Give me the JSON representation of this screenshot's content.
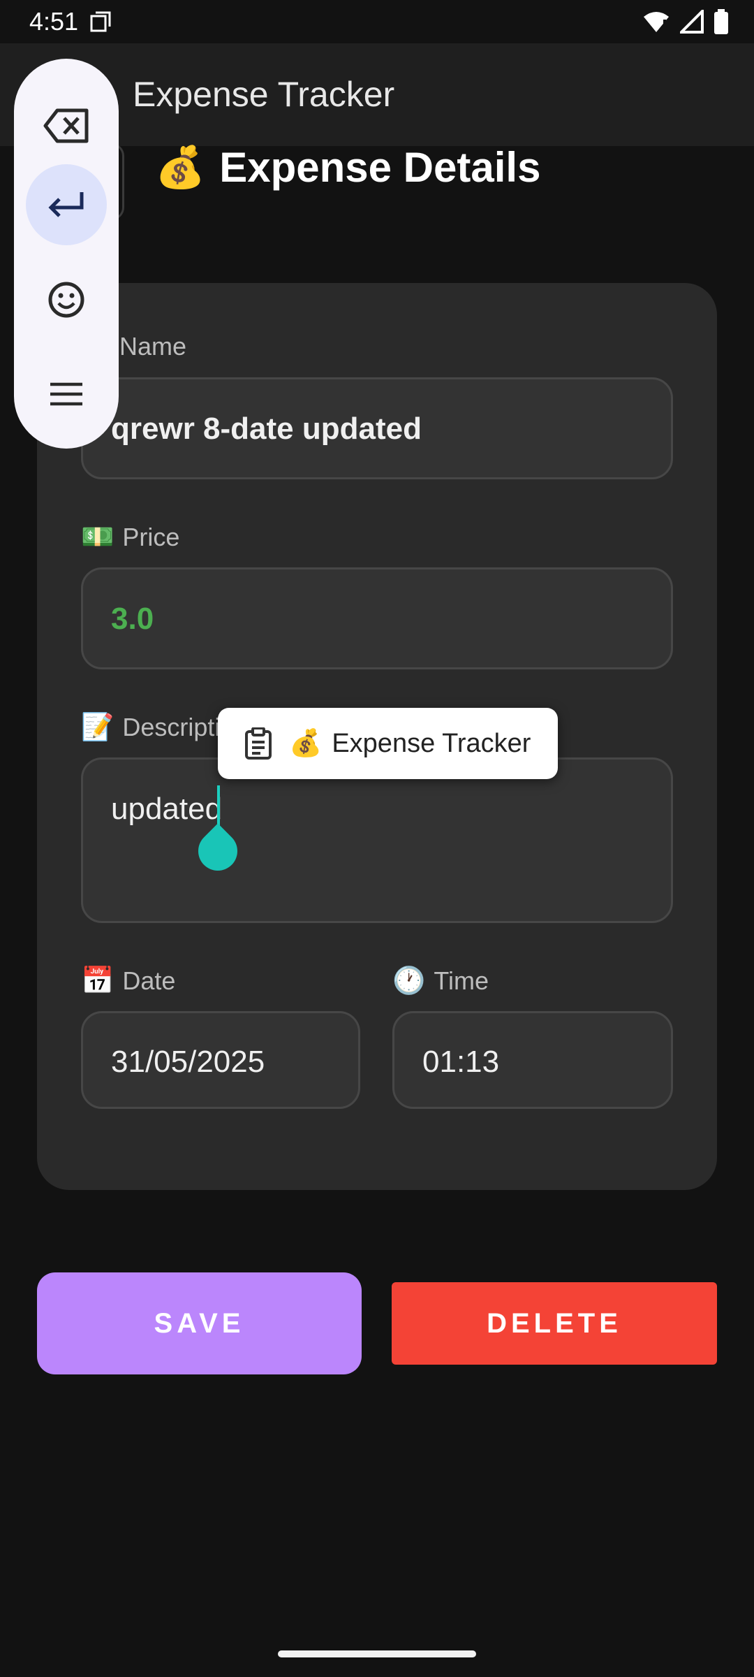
{
  "status_bar": {
    "time": "4:51"
  },
  "app_bar": {
    "title": "Expense Tracker"
  },
  "page": {
    "title": "Expense Details",
    "title_emoji": "💰"
  },
  "form": {
    "name": {
      "label": "Name",
      "value": "qrewr 8-date updated"
    },
    "price": {
      "label": "Price",
      "emoji": "💵",
      "value": "3.0",
      "value_color": "#4caf50"
    },
    "description": {
      "label": "Descripti",
      "emoji": "📝",
      "value": "updated"
    },
    "date": {
      "label": "Date",
      "emoji": "📅",
      "value": "31/05/2025"
    },
    "time": {
      "label": "Time",
      "emoji": "🕐",
      "value": "01:13"
    }
  },
  "clipboard_popup": {
    "emoji": "💰",
    "text": "Expense Tracker"
  },
  "actions": {
    "save_label": "SAVE",
    "delete_label": "DELETE"
  },
  "colors": {
    "save": "#bb86fc",
    "delete": "#f44336",
    "cursor": "#1ccfc0"
  },
  "keyboard_toolbar": {
    "icons": [
      "backspace-icon",
      "enter-icon",
      "emoji-icon",
      "menu-icon"
    ],
    "active": "enter-icon"
  }
}
